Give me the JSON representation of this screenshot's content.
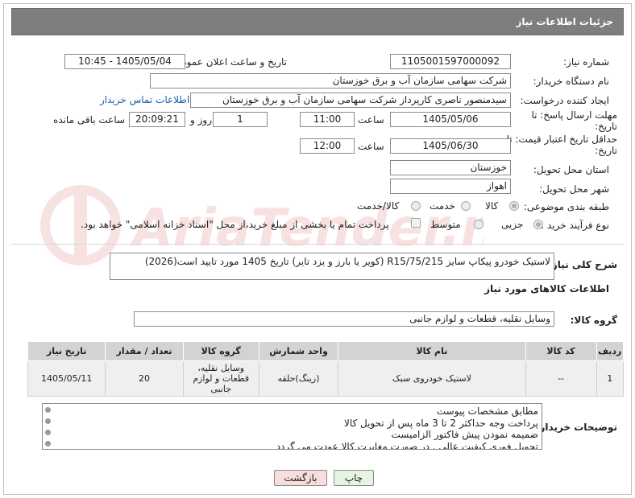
{
  "header": {
    "title": "جزئیات اطلاعات نیاز"
  },
  "fields": {
    "need_number_label": "شماره نیاز:",
    "need_number": "1105001597000092",
    "announce_label": "تاریخ و ساعت اعلان عمومی:",
    "announce_value": "1405/05/04 - 10:45",
    "buyer_label": "نام دستگاه خریدار:",
    "buyer_value": "شرکت سهامی سازمان آب و برق خوزستان",
    "creator_label": "ایجاد کننده درخواست:",
    "creator_value": "سیدمنصور ناصری کارپرداز شرکت سهامی سازمان آب و برق خوزستان",
    "contact_link": "اطلاعات تماس خریدار",
    "deadline_label": "مهلت ارسال پاسخ: تا تاریخ:",
    "deadline_date": "1405/05/06",
    "time_label": "ساعت",
    "deadline_time": "11:00",
    "days_value": "1",
    "days_label": "روز و",
    "remaining_time": "20:09:21",
    "remaining_label": "ساعت باقی مانده",
    "validity_label": "حداقل تاریخ اعتبار قیمت: تا تاریخ:",
    "validity_date": "1405/06/30",
    "validity_time": "12:00",
    "province_label": "استان محل تحویل:",
    "province_value": "خوزستان",
    "city_label": "شهر محل تحویل:",
    "city_value": "اهواز",
    "category_label": "طبقه بندی موضوعی:",
    "category_options": [
      "کالا",
      "خدمت",
      "کالا/خدمت"
    ],
    "process_label": "نوع فرآیند خرید :",
    "process_options": [
      "جزیی",
      "متوسط"
    ],
    "payment_note": "پرداخت تمام یا بخشی از مبلغ خرید،از محل \"اسناد خزانه اسلامی\" خواهد بود."
  },
  "description": {
    "label": "شرح کلی نیاز:",
    "value": "لاستیک خودرو پیکاپ سایز R15/75/215  (کویر یا بارز و یزد تایر) تاریخ 1405 مورد تایید است(2026)"
  },
  "goods_info_title": "اطلاعات کالاهای مورد نیاز",
  "goods_group": {
    "label": "گروه کالا:",
    "value": "وسایل نقلیه، قطعات و لوازم جانبی"
  },
  "table": {
    "headers": [
      "ردیف",
      "کد کالا",
      "نام کالا",
      "واحد شمارش",
      "گروه کالا",
      "تعداد / مقدار",
      "تاریخ نیاز"
    ],
    "rows": [
      [
        "1",
        "--",
        "لاستیک خودروی سبک",
        "(رینگ)حلقه",
        "وسایل نقلیه، قطعات و لوازم جانبی",
        "20",
        "1405/05/11"
      ]
    ]
  },
  "buyer_notes": {
    "label": "توضیحات خریدار:",
    "lines": [
      "مطابق مشخصات پیوست",
      "پرداخت وجه حداکثر 2 تا 3 ماه پس از تحویل کالا",
      "ضمیمه نمودن پیش فاکتور الزامیست",
      "تحویل فوری کیفیت عالی . در صورت مغایرت کالا عودت می گردد"
    ]
  },
  "buttons": {
    "print": "چاپ",
    "back": "بازگشت"
  },
  "colors": {
    "header_bg": "#7e7e7e",
    "link": "#1a5fa8",
    "print_btn": "#e6f5e0",
    "back_btn": "#f7dede"
  }
}
